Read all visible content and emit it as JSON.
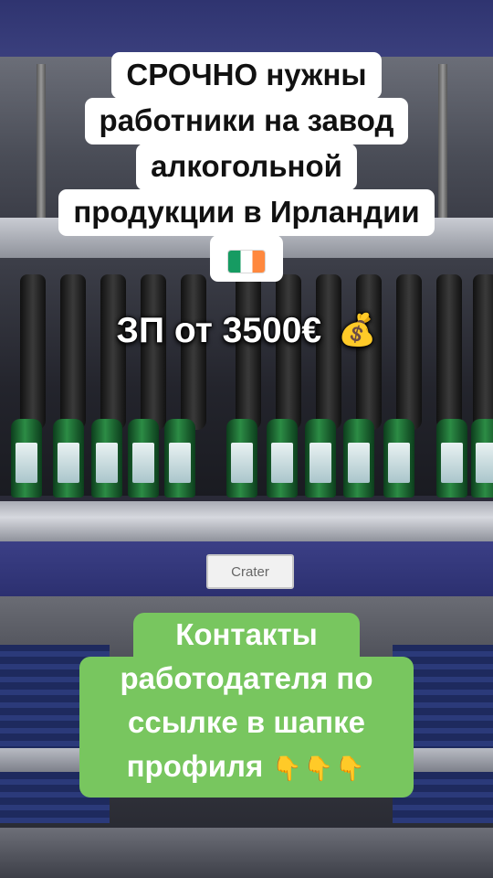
{
  "headline": {
    "line1": "СРОЧНО нужны",
    "line2": "работники на завод",
    "line3": "алкогольной",
    "line4": "продукции в Ирландии",
    "flag_icon": "ireland-flag-icon"
  },
  "salary": {
    "text": "ЗП от 3500€",
    "icon": "moneybag-icon",
    "icon_glyph": "💰"
  },
  "contacts": {
    "line1": "Контакты",
    "line2": "работодателя по",
    "line3": "ссылке в шапке",
    "line4": "профиля",
    "icon": "pointing-down-hands-icon",
    "icon_glyph": "👇👇👇"
  },
  "scene": {
    "tag_label": "Crater",
    "colors": {
      "caption_bg": "#ffffff",
      "contacts_bg": "#78c65f",
      "flag_green": "#169b62",
      "flag_orange": "#ff883e"
    }
  }
}
